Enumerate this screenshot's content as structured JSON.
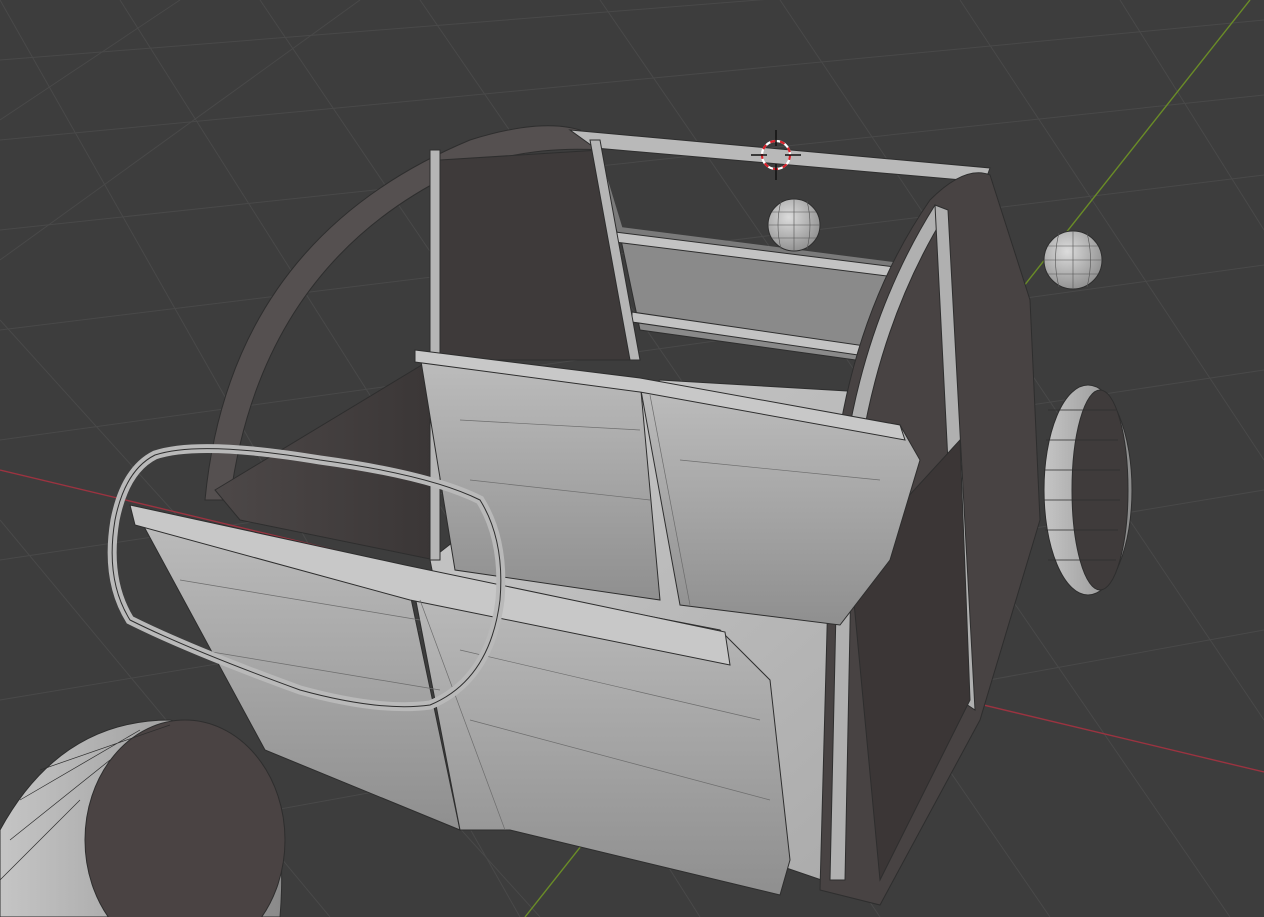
{
  "app": {
    "view": "3d-viewport",
    "mode": "wireframe-overlay-solid",
    "icons": [
      "3d-cursor-icon"
    ]
  },
  "scene": {
    "objects": [
      "car-body-frame",
      "front-seat",
      "rear-seat",
      "steering-wheel",
      "wheel-front-left",
      "wheel-rear-right",
      "sphere-headlight-left",
      "sphere-headlight-right"
    ]
  },
  "colors": {
    "background": "#3d3d3d",
    "grid": "#494949",
    "x_axis": "#9b3340",
    "y_axis": "#6a8c27",
    "mesh_light": "#b5b5b5",
    "mesh_mid": "#9d9d9d",
    "mesh_dark": "#4a4444",
    "edge": "#2e2e2e",
    "cursor_red": "#d9212b"
  }
}
